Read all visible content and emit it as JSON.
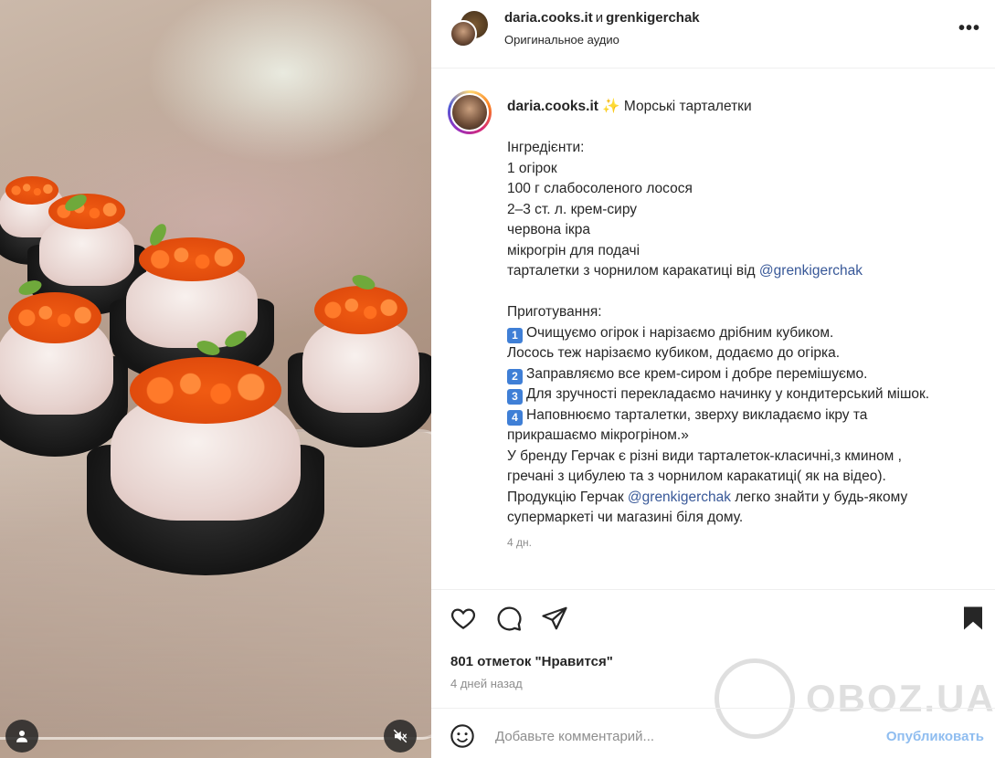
{
  "post": {
    "author": "daria.cooks.it",
    "conjunction": "и",
    "collaborator": "grenkigerchak",
    "audio": "Оригинальное аудио",
    "more_label": "•••"
  },
  "caption": {
    "username": "daria.cooks.it",
    "sparkle": "✨",
    "title": "Морські тарталетки",
    "lines_ingredients": [
      "Інгредієнти:",
      "1 огірок",
      "100 г слабосоленого лосося",
      "2–3 ст. л. крем-сиру",
      "червона ікра",
      "мікрогрін для подачі"
    ],
    "tartlets_line": "тарталетки з чорнилом каракатиці від ",
    "mention": "@grenkigerchak",
    "prep_heading": "Приготування:",
    "steps": [
      {
        "num": "1",
        "text": "Очищуємо огірок і нарізаємо дрібним кубиком."
      },
      {
        "num": "",
        "text": "Лосось теж нарізаємо кубиком, додаємо до огірка."
      },
      {
        "num": "2",
        "text": "Заправляємо все крем-сиром і добре перемішуємо."
      },
      {
        "num": "3",
        "text": "Для зручності перекладаємо начинку у кондитерський мішок."
      },
      {
        "num": "4",
        "text": "Наповнюємо тарталетки, зверху викладаємо ікру та"
      },
      {
        "num": "",
        "text": "прикрашаємо мікрогріном.»"
      }
    ],
    "brand_lines": [
      "У бренду Герчак є різні види тарталеток-класичні,з кмином ,",
      "гречані з цибулею та з чорнилом каракатиці( як на відео)."
    ],
    "product_prefix": "Продукцію Герчак ",
    "product_mention": "@grenkigerchak",
    "product_suffix": " легко знайти у будь-якому",
    "product_end": "супермаркеті чи магазині біля дому.",
    "time": "4 дн."
  },
  "engagement": {
    "likes": "801 отметок \"Нравится\"",
    "ago": "4 дней назад"
  },
  "comment": {
    "placeholder": "Добавьте комментарий...",
    "publish": "Опубликовать"
  },
  "watermark": "OBOZ.UA",
  "colors": {
    "link": "#385898",
    "publish": "#8fbdf0",
    "muted": "#8e8e8e",
    "step_badge": "#3f7fd6"
  }
}
